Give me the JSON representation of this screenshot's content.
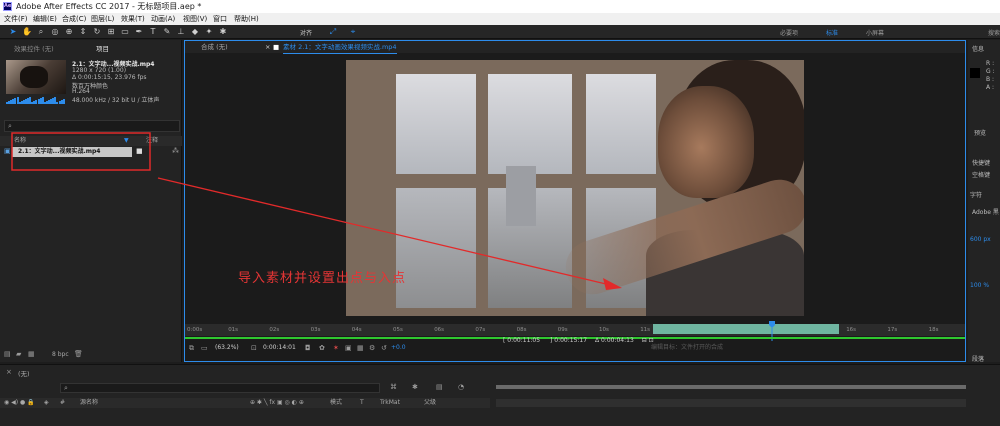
{
  "window": {
    "title": "Adobe After Effects CC 2017 - 无标题项目.aep *",
    "logo": "Ae"
  },
  "menu": [
    "文件(F)",
    "编辑(E)",
    "合成(C)",
    "图层(L)",
    "效果(T)",
    "动画(A)",
    "视图(V)",
    "窗口",
    "帮助(H)"
  ],
  "toolbar": {
    "align_label": "对齐",
    "workspaces": [
      "必要项",
      "标准",
      "小屏幕"
    ],
    "active_workspace": "标准",
    "search_label": "搜索"
  },
  "project_panel": {
    "tabs": [
      "效果控件 (无)",
      "项目"
    ],
    "footage_name": "2.1：文字动...视频实战.mp4",
    "meta": [
      "1280 x 720 (1.00)",
      "Δ 0:00:15:15, 23.976 fps",
      "数百万种颜色",
      "H.264",
      "48.000 kHz / 32 bit U / 立体声"
    ],
    "columns": [
      "名称",
      "注释"
    ],
    "item_name": "2.1：文字动...视频实战.mp4",
    "bit_depth": "8 bpc"
  },
  "composition_panel": {
    "tab_comp": "合成 (无)",
    "tab_footage": "素材 2.1：文字动画效果视频实战.mp4",
    "annotation": "导入素材并设置出点与入点",
    "ruler_labels": [
      "0:00s",
      "01s",
      "02s",
      "03s",
      "04s",
      "05s",
      "06s",
      "07s",
      "08s",
      "09s",
      "10s",
      "11s",
      "12s",
      "13s",
      "14s",
      "15s",
      "16s",
      "17s",
      "18s"
    ],
    "in_point": "0:00:11:05",
    "out_point": "0:00:15:17",
    "duration": "Δ 0:00:04:13",
    "zoom": "(63.2%)",
    "current_time": "0:00:14:01",
    "exposure": "+0.0",
    "overlay_hint": "编辑目标：文件打开的合成"
  },
  "right_panel": {
    "labels": [
      "信息",
      "R :",
      "G :",
      "B :",
      "A :",
      "预览",
      "快捷键",
      "空格键",
      "字符",
      "Adobe 黑",
      "600 px",
      "100 %",
      "段落"
    ]
  },
  "timeline_panel": {
    "tab": "(无)",
    "columns": [
      "源名称",
      "模式",
      "T",
      "TrkMat",
      "父级"
    ]
  },
  "colors": {
    "accent": "#2d8ceb",
    "annotation": "#e53535",
    "work_area": "#6fb5a1",
    "timebar": "#2fc72f"
  }
}
